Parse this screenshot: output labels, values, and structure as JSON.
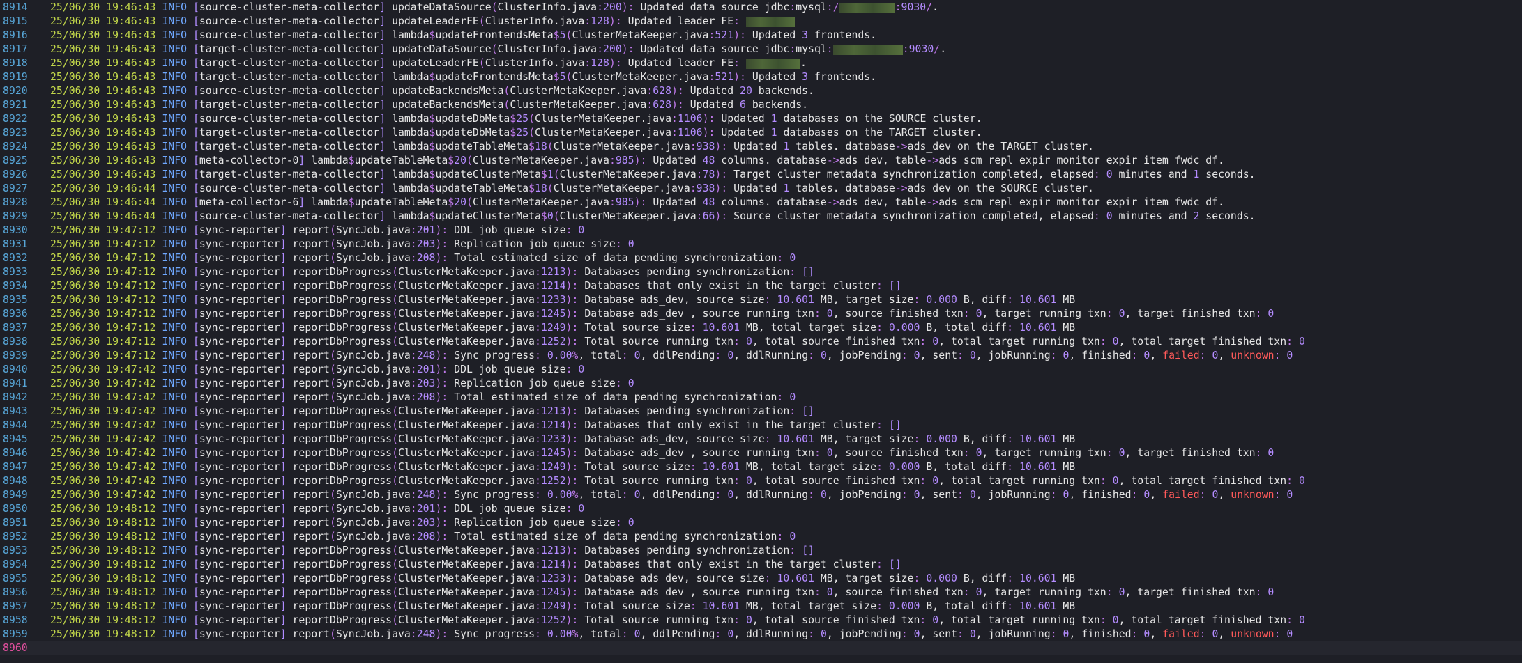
{
  "log_lines": [
    {
      "n": "8914",
      "ts": "25/06/30 19:46:43",
      "level": "INFO",
      "thread": "source-cluster-meta-collector",
      "method": "updateDataSource",
      "loc": "ClusterInfo.java",
      "line": "200",
      "msg": "Updated data source jdbc:mysql:/",
      "redacted_width": 80,
      "msg_after": ":9030/."
    },
    {
      "n": "8915",
      "ts": "25/06/30 19:46:43",
      "level": "INFO",
      "thread": "source-cluster-meta-collector",
      "method": "updateLeaderFE",
      "loc": "ClusterInfo.java",
      "line": "128",
      "msg": "Updated leader FE: ",
      "redacted_width": 70,
      "msg_after": ""
    },
    {
      "n": "8916",
      "ts": "25/06/30 19:46:43",
      "level": "INFO",
      "thread": "source-cluster-meta-collector",
      "method": "lambda$updateFrontendsMeta$5",
      "loc": "ClusterMetaKeeper.java",
      "line": "521",
      "msg": "Updated 3 frontends."
    },
    {
      "n": "8917",
      "ts": "25/06/30 19:46:43",
      "level": "INFO",
      "thread": "target-cluster-meta-collector",
      "method": "updateDataSource",
      "loc": "ClusterInfo.java",
      "line": "200",
      "msg": "Updated data source jdbc:mysql:",
      "redacted_width": 100,
      "msg_after": ":9030/."
    },
    {
      "n": "8918",
      "ts": "25/06/30 19:46:43",
      "level": "INFO",
      "thread": "target-cluster-meta-collector",
      "method": "updateLeaderFE",
      "loc": "ClusterInfo.java",
      "line": "128",
      "msg": "Updated leader FE: ",
      "redacted_width": 78,
      "msg_after": "."
    },
    {
      "n": "8919",
      "ts": "25/06/30 19:46:43",
      "level": "INFO",
      "thread": "target-cluster-meta-collector",
      "method": "lambda$updateFrontendsMeta$5",
      "loc": "ClusterMetaKeeper.java",
      "line": "521",
      "msg": "Updated 3 frontends."
    },
    {
      "n": "8920",
      "ts": "25/06/30 19:46:43",
      "level": "INFO",
      "thread": "source-cluster-meta-collector",
      "method": "updateBackendsMeta",
      "loc": "ClusterMetaKeeper.java",
      "line": "628",
      "msg": "Updated 20 backends."
    },
    {
      "n": "8921",
      "ts": "25/06/30 19:46:43",
      "level": "INFO",
      "thread": "target-cluster-meta-collector",
      "method": "updateBackendsMeta",
      "loc": "ClusterMetaKeeper.java",
      "line": "628",
      "msg": "Updated 6 backends."
    },
    {
      "n": "8922",
      "ts": "25/06/30 19:46:43",
      "level": "INFO",
      "thread": "source-cluster-meta-collector",
      "method": "lambda$updateDbMeta$25",
      "loc": "ClusterMetaKeeper.java",
      "line": "1106",
      "msg": "Updated 1 databases on the SOURCE cluster."
    },
    {
      "n": "8923",
      "ts": "25/06/30 19:46:43",
      "level": "INFO",
      "thread": "target-cluster-meta-collector",
      "method": "lambda$updateDbMeta$25",
      "loc": "ClusterMetaKeeper.java",
      "line": "1106",
      "msg": "Updated 1 databases on the TARGET cluster."
    },
    {
      "n": "8924",
      "ts": "25/06/30 19:46:43",
      "level": "INFO",
      "thread": "target-cluster-meta-collector",
      "method": "lambda$updateTableMeta$18",
      "loc": "ClusterMetaKeeper.java",
      "line": "938",
      "msg": "Updated 1 tables. database->ads_dev on the TARGET cluster."
    },
    {
      "n": "8925",
      "ts": "25/06/30 19:46:43",
      "level": "INFO",
      "thread": "meta-collector-0",
      "method": "lambda$updateTableMeta$20",
      "loc": "ClusterMetaKeeper.java",
      "line": "985",
      "msg": "Updated 48 columns. database->ads_dev, table->ads_scm_repl_expir_monitor_expir_item_fwdc_df."
    },
    {
      "n": "8926",
      "ts": "25/06/30 19:46:43",
      "level": "INFO",
      "thread": "target-cluster-meta-collector",
      "method": "lambda$updateClusterMeta$1",
      "loc": "ClusterMetaKeeper.java",
      "line": "78",
      "msg": "Target cluster metadata synchronization completed, elapsed: 0 minutes and 1 seconds."
    },
    {
      "n": "8927",
      "ts": "25/06/30 19:46:44",
      "level": "INFO",
      "thread": "source-cluster-meta-collector",
      "method": "lambda$updateTableMeta$18",
      "loc": "ClusterMetaKeeper.java",
      "line": "938",
      "msg": "Updated 1 tables. database->ads_dev on the SOURCE cluster."
    },
    {
      "n": "8928",
      "ts": "25/06/30 19:46:44",
      "level": "INFO",
      "thread": "meta-collector-6",
      "method": "lambda$updateTableMeta$20",
      "loc": "ClusterMetaKeeper.java",
      "line": "985",
      "msg": "Updated 48 columns. database->ads_dev, table->ads_scm_repl_expir_monitor_expir_item_fwdc_df."
    },
    {
      "n": "8929",
      "ts": "25/06/30 19:46:44",
      "level": "INFO",
      "thread": "source-cluster-meta-collector",
      "method": "lambda$updateClusterMeta$0",
      "loc": "ClusterMetaKeeper.java",
      "line": "66",
      "msg": "Source cluster metadata synchronization completed, elapsed: 0 minutes and 2 seconds."
    },
    {
      "n": "8930",
      "ts": "25/06/30 19:47:12",
      "level": "INFO",
      "thread": "sync-reporter",
      "method": "report",
      "loc": "SyncJob.java",
      "line": "201",
      "msg": "DDL job queue size: 0"
    },
    {
      "n": "8931",
      "ts": "25/06/30 19:47:12",
      "level": "INFO",
      "thread": "sync-reporter",
      "method": "report",
      "loc": "SyncJob.java",
      "line": "203",
      "msg": "Replication job queue size: 0"
    },
    {
      "n": "8932",
      "ts": "25/06/30 19:47:12",
      "level": "INFO",
      "thread": "sync-reporter",
      "method": "report",
      "loc": "SyncJob.java",
      "line": "208",
      "msg": "Total estimated size of data pending synchronization: 0"
    },
    {
      "n": "8933",
      "ts": "25/06/30 19:47:12",
      "level": "INFO",
      "thread": "sync-reporter",
      "method": "reportDbProgress",
      "loc": "ClusterMetaKeeper.java",
      "line": "1213",
      "msg": "Databases pending synchronization: []"
    },
    {
      "n": "8934",
      "ts": "25/06/30 19:47:12",
      "level": "INFO",
      "thread": "sync-reporter",
      "method": "reportDbProgress",
      "loc": "ClusterMetaKeeper.java",
      "line": "1214",
      "msg": "Databases that only exist in the target cluster: []"
    },
    {
      "n": "8935",
      "ts": "25/06/30 19:47:12",
      "level": "INFO",
      "thread": "sync-reporter",
      "method": "reportDbProgress",
      "loc": "ClusterMetaKeeper.java",
      "line": "1233",
      "msg": "Database ads_dev, source size: 10.601 MB, target size: 0.000 B, diff: 10.601 MB"
    },
    {
      "n": "8936",
      "ts": "25/06/30 19:47:12",
      "level": "INFO",
      "thread": "sync-reporter",
      "method": "reportDbProgress",
      "loc": "ClusterMetaKeeper.java",
      "line": "1245",
      "msg": "Database ads_dev , source running txn: 0, source finished txn: 0, target running txn: 0, target finished txn: 0"
    },
    {
      "n": "8937",
      "ts": "25/06/30 19:47:12",
      "level": "INFO",
      "thread": "sync-reporter",
      "method": "reportDbProgress",
      "loc": "ClusterMetaKeeper.java",
      "line": "1249",
      "msg": "Total source size: 10.601 MB, total target size: 0.000 B, total diff: 10.601 MB"
    },
    {
      "n": "8938",
      "ts": "25/06/30 19:47:12",
      "level": "INFO",
      "thread": "sync-reporter",
      "method": "reportDbProgress",
      "loc": "ClusterMetaKeeper.java",
      "line": "1252",
      "msg": "Total source running txn: 0, total source finished txn: 0, total target running txn: 0, total target finished txn: 0"
    },
    {
      "n": "8939",
      "ts": "25/06/30 19:47:12",
      "level": "INFO",
      "thread": "sync-reporter",
      "method": "report",
      "loc": "SyncJob.java",
      "line": "248",
      "msg": "Sync progress: 0.00%, total: 0, ddlPending: 0, ddlRunning: 0, jobPending: 0, sent: 0, jobRunning: 0, finished: 0, failed: 0, unknown: 0"
    },
    {
      "n": "8940",
      "ts": "25/06/30 19:47:42",
      "level": "INFO",
      "thread": "sync-reporter",
      "method": "report",
      "loc": "SyncJob.java",
      "line": "201",
      "msg": "DDL job queue size: 0"
    },
    {
      "n": "8941",
      "ts": "25/06/30 19:47:42",
      "level": "INFO",
      "thread": "sync-reporter",
      "method": "report",
      "loc": "SyncJob.java",
      "line": "203",
      "msg": "Replication job queue size: 0"
    },
    {
      "n": "8942",
      "ts": "25/06/30 19:47:42",
      "level": "INFO",
      "thread": "sync-reporter",
      "method": "report",
      "loc": "SyncJob.java",
      "line": "208",
      "msg": "Total estimated size of data pending synchronization: 0"
    },
    {
      "n": "8943",
      "ts": "25/06/30 19:47:42",
      "level": "INFO",
      "thread": "sync-reporter",
      "method": "reportDbProgress",
      "loc": "ClusterMetaKeeper.java",
      "line": "1213",
      "msg": "Databases pending synchronization: []"
    },
    {
      "n": "8944",
      "ts": "25/06/30 19:47:42",
      "level": "INFO",
      "thread": "sync-reporter",
      "method": "reportDbProgress",
      "loc": "ClusterMetaKeeper.java",
      "line": "1214",
      "msg": "Databases that only exist in the target cluster: []"
    },
    {
      "n": "8945",
      "ts": "25/06/30 19:47:42",
      "level": "INFO",
      "thread": "sync-reporter",
      "method": "reportDbProgress",
      "loc": "ClusterMetaKeeper.java",
      "line": "1233",
      "msg": "Database ads_dev, source size: 10.601 MB, target size: 0.000 B, diff: 10.601 MB"
    },
    {
      "n": "8946",
      "ts": "25/06/30 19:47:42",
      "level": "INFO",
      "thread": "sync-reporter",
      "method": "reportDbProgress",
      "loc": "ClusterMetaKeeper.java",
      "line": "1245",
      "msg": "Database ads_dev , source running txn: 0, source finished txn: 0, target running txn: 0, target finished txn: 0"
    },
    {
      "n": "8947",
      "ts": "25/06/30 19:47:42",
      "level": "INFO",
      "thread": "sync-reporter",
      "method": "reportDbProgress",
      "loc": "ClusterMetaKeeper.java",
      "line": "1249",
      "msg": "Total source size: 10.601 MB, total target size: 0.000 B, total diff: 10.601 MB"
    },
    {
      "n": "8948",
      "ts": "25/06/30 19:47:42",
      "level": "INFO",
      "thread": "sync-reporter",
      "method": "reportDbProgress",
      "loc": "ClusterMetaKeeper.java",
      "line": "1252",
      "msg": "Total source running txn: 0, total source finished txn: 0, total target running txn: 0, total target finished txn: 0"
    },
    {
      "n": "8949",
      "ts": "25/06/30 19:47:42",
      "level": "INFO",
      "thread": "sync-reporter",
      "method": "report",
      "loc": "SyncJob.java",
      "line": "248",
      "msg": "Sync progress: 0.00%, total: 0, ddlPending: 0, ddlRunning: 0, jobPending: 0, sent: 0, jobRunning: 0, finished: 0, failed: 0, unknown: 0"
    },
    {
      "n": "8950",
      "ts": "25/06/30 19:48:12",
      "level": "INFO",
      "thread": "sync-reporter",
      "method": "report",
      "loc": "SyncJob.java",
      "line": "201",
      "msg": "DDL job queue size: 0"
    },
    {
      "n": "8951",
      "ts": "25/06/30 19:48:12",
      "level": "INFO",
      "thread": "sync-reporter",
      "method": "report",
      "loc": "SyncJob.java",
      "line": "203",
      "msg": "Replication job queue size: 0"
    },
    {
      "n": "8952",
      "ts": "25/06/30 19:48:12",
      "level": "INFO",
      "thread": "sync-reporter",
      "method": "report",
      "loc": "SyncJob.java",
      "line": "208",
      "msg": "Total estimated size of data pending synchronization: 0"
    },
    {
      "n": "8953",
      "ts": "25/06/30 19:48:12",
      "level": "INFO",
      "thread": "sync-reporter",
      "method": "reportDbProgress",
      "loc": "ClusterMetaKeeper.java",
      "line": "1213",
      "msg": "Databases pending synchronization: []"
    },
    {
      "n": "8954",
      "ts": "25/06/30 19:48:12",
      "level": "INFO",
      "thread": "sync-reporter",
      "method": "reportDbProgress",
      "loc": "ClusterMetaKeeper.java",
      "line": "1214",
      "msg": "Databases that only exist in the target cluster: []"
    },
    {
      "n": "8955",
      "ts": "25/06/30 19:48:12",
      "level": "INFO",
      "thread": "sync-reporter",
      "method": "reportDbProgress",
      "loc": "ClusterMetaKeeper.java",
      "line": "1233",
      "msg": "Database ads_dev, source size: 10.601 MB, target size: 0.000 B, diff: 10.601 MB"
    },
    {
      "n": "8956",
      "ts": "25/06/30 19:48:12",
      "level": "INFO",
      "thread": "sync-reporter",
      "method": "reportDbProgress",
      "loc": "ClusterMetaKeeper.java",
      "line": "1245",
      "msg": "Database ads_dev , source running txn: 0, source finished txn: 0, target running txn: 0, target finished txn: 0"
    },
    {
      "n": "8957",
      "ts": "25/06/30 19:48:12",
      "level": "INFO",
      "thread": "sync-reporter",
      "method": "reportDbProgress",
      "loc": "ClusterMetaKeeper.java",
      "line": "1249",
      "msg": "Total source size: 10.601 MB, total target size: 0.000 B, total diff: 10.601 MB"
    },
    {
      "n": "8958",
      "ts": "25/06/30 19:48:12",
      "level": "INFO",
      "thread": "sync-reporter",
      "method": "reportDbProgress",
      "loc": "ClusterMetaKeeper.java",
      "line": "1252",
      "msg": "Total source running txn: 0, total source finished txn: 0, total target running txn: 0, total target finished txn: 0"
    },
    {
      "n": "8959",
      "ts": "25/06/30 19:48:12",
      "level": "INFO",
      "thread": "sync-reporter",
      "method": "report",
      "loc": "SyncJob.java",
      "line": "248",
      "msg": "Sync progress: 0.00%, total: 0, ddlPending: 0, ddlRunning: 0, jobPending: 0, sent: 0, jobRunning: 0, finished: 0, failed: 0, unknown: 0"
    }
  ],
  "current_line": {
    "n": "8960"
  },
  "colors": {
    "background": "#1e1f26",
    "line_number": "#57a5d6",
    "timestamp": "#c3d84a",
    "level": "#6fa8ff",
    "literal": "#b48cff",
    "error_word": "#ff5a5a",
    "current_line_number": "#e04f9d"
  }
}
